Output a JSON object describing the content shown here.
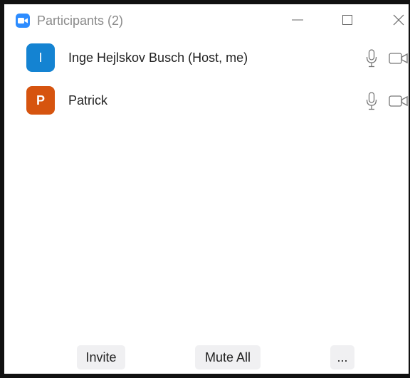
{
  "window": {
    "title": "Participants (2)"
  },
  "participants": [
    {
      "initial": "I",
      "name": "Inge Hejlskov Busch (Host, me)",
      "avatar_color": "#1483D2",
      "mic_icon": "microphone-icon",
      "video_icon": "video-camera-icon"
    },
    {
      "initial": "P",
      "name": "Patrick",
      "avatar_color": "#D6540F",
      "mic_icon": "microphone-icon",
      "video_icon": "video-camera-icon"
    }
  ],
  "footer": {
    "invite_label": "Invite",
    "mute_all_label": "Mute All",
    "more_label": "..."
  },
  "colors": {
    "app_icon": "#2D8CFF",
    "button_bg": "#f0f0f2"
  }
}
